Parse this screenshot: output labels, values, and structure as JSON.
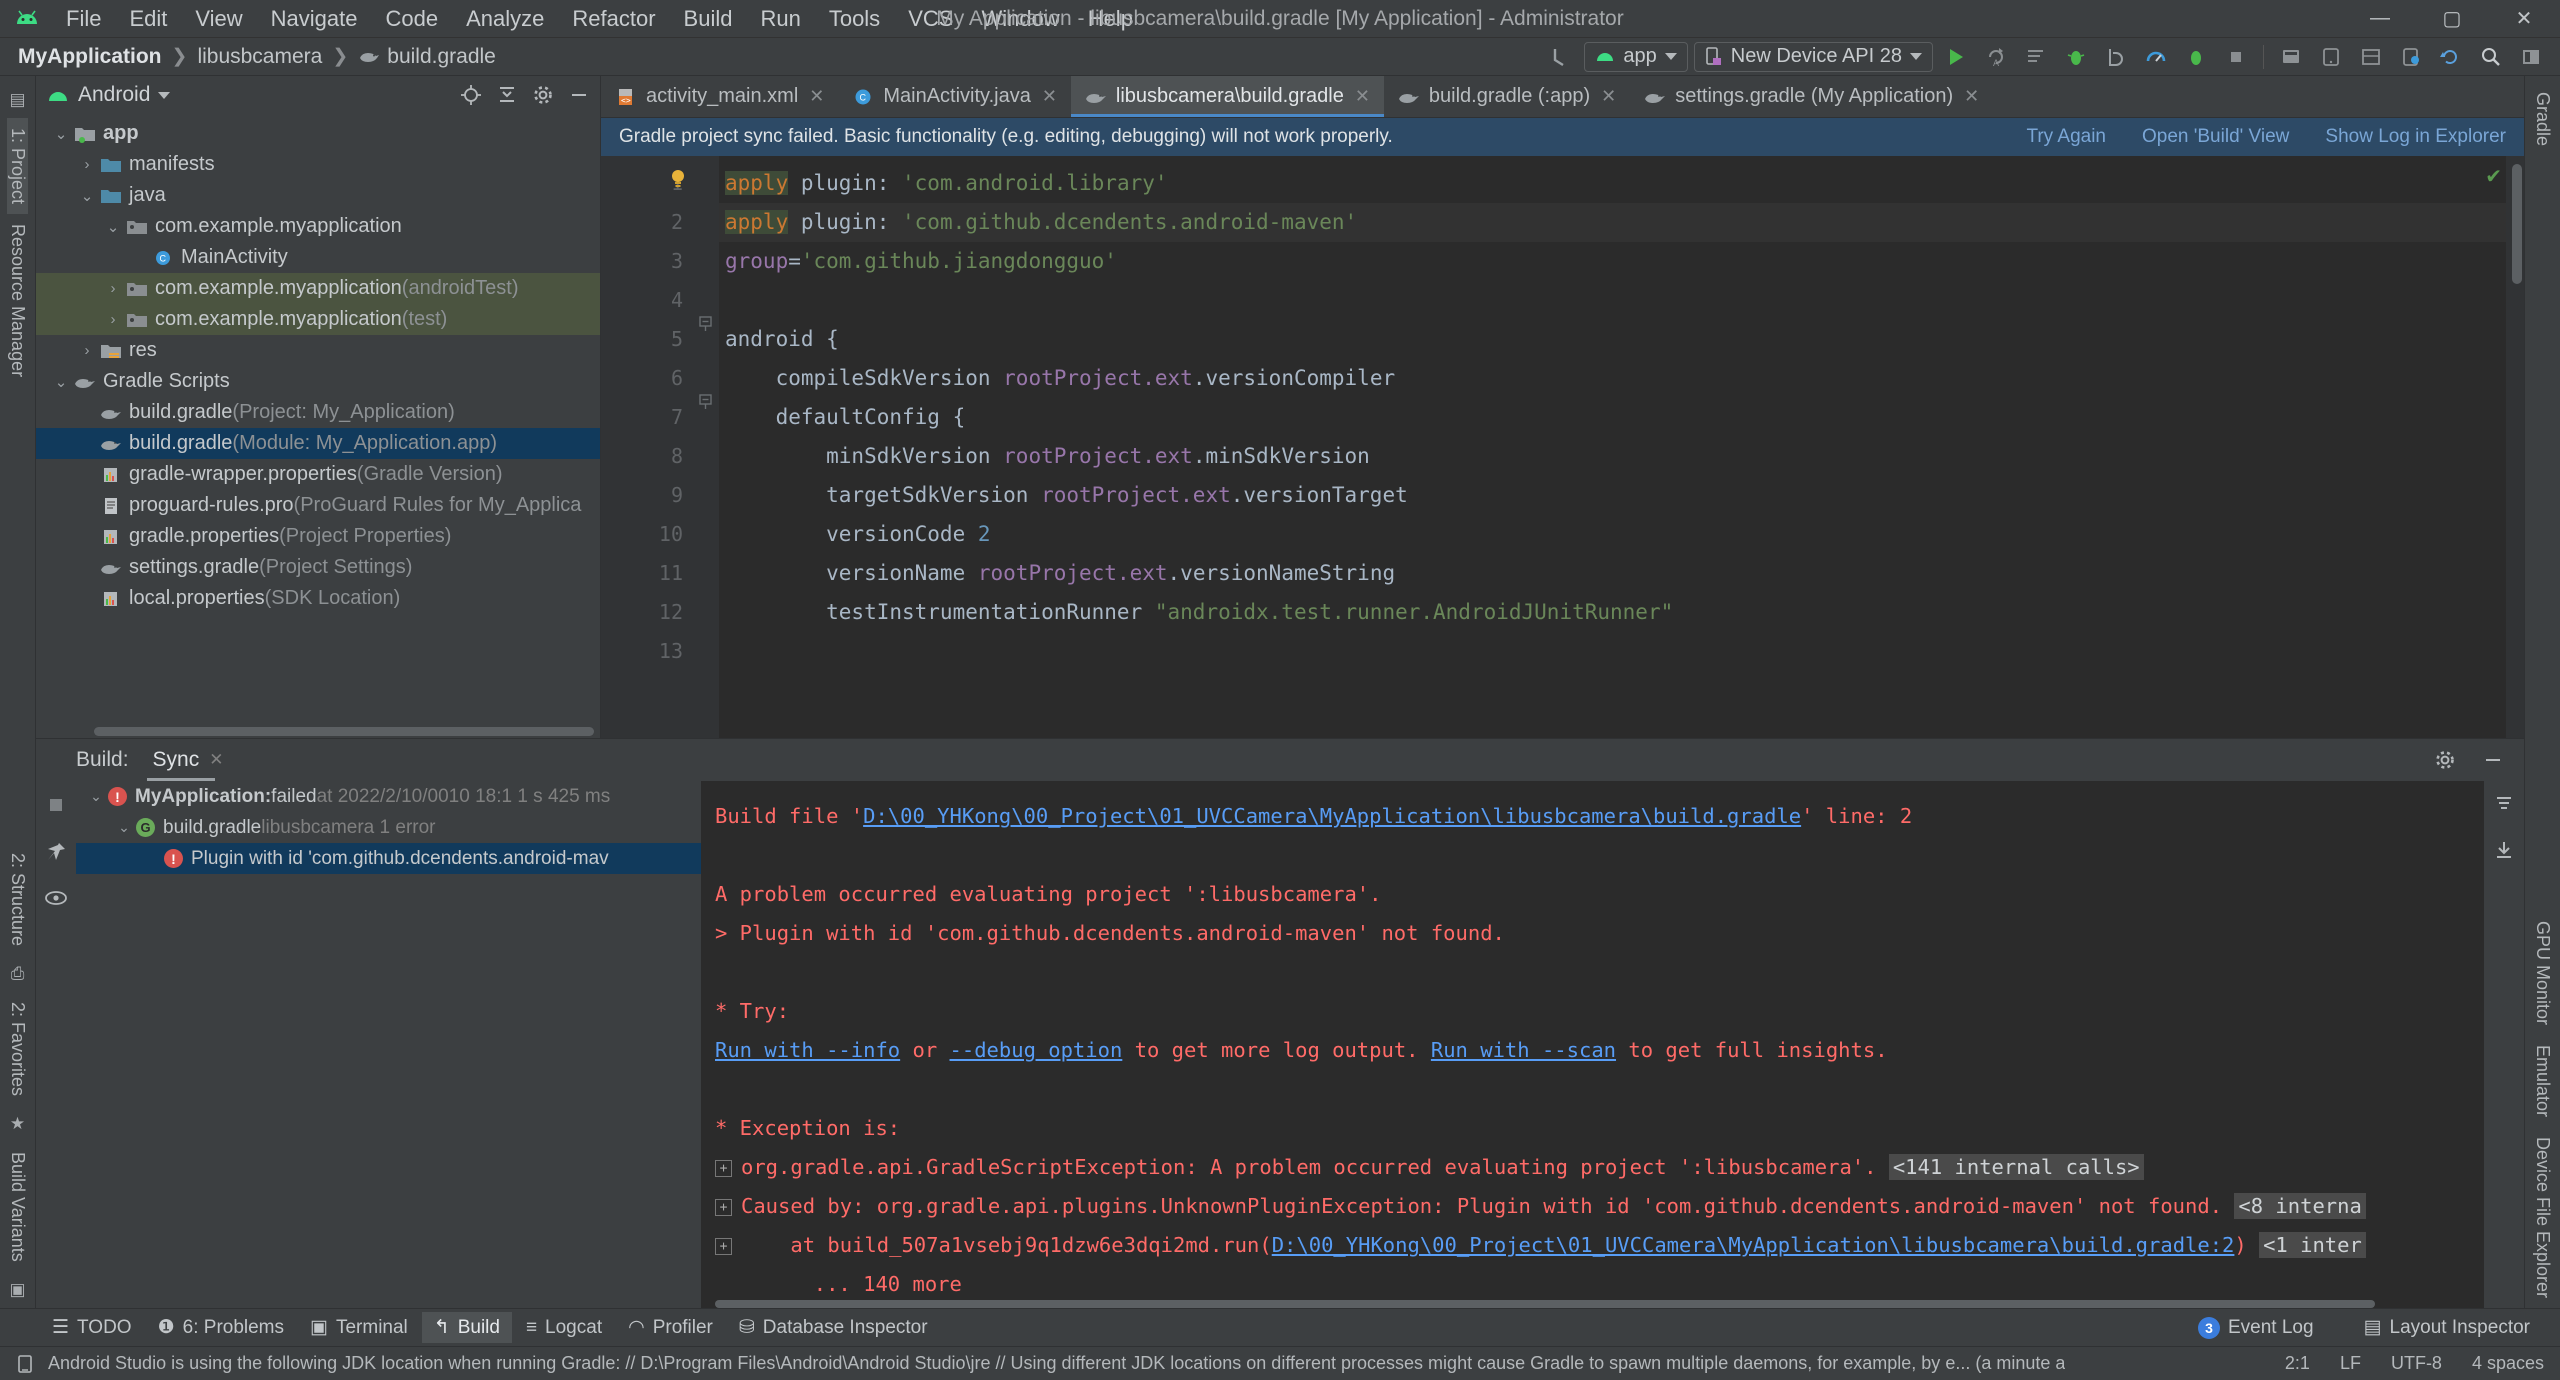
{
  "window": {
    "title": "My Application - libusbcamera\\build.gradle [My Application] - Administrator",
    "minimize": "—",
    "maximize": "▢",
    "close": "✕"
  },
  "menu": [
    "File",
    "Edit",
    "View",
    "Navigate",
    "Code",
    "Analyze",
    "Refactor",
    "Build",
    "Run",
    "Tools",
    "VCS",
    "Window",
    "Help"
  ],
  "breadcrumb": [
    {
      "label": "MyApplication",
      "bold": true
    },
    {
      "label": "libusbcamera",
      "bold": false
    },
    {
      "label": "build.gradle",
      "bold": false,
      "icon": "gradle-icon"
    }
  ],
  "toolbar": {
    "back_label": "↰",
    "module_combo": "app",
    "device_combo": "New Device API 28",
    "icons": [
      "run-icon",
      "apply-changes-icon",
      "apply-code-changes-icon",
      "debug-icon",
      "attach-debugger-icon",
      "profiler-icon",
      "profile-icon",
      "stop-icon",
      "sdk-manager-icon",
      "avd-manager-icon",
      "layout-inspector-icon",
      "device-file-explorer-icon",
      "sync-gradle-icon",
      "search-icon",
      "project-structure-icon"
    ]
  },
  "project_panel": {
    "title": "Android",
    "head_icons": [
      "locate-icon",
      "collapse-all-icon",
      "settings-icon",
      "hide-icon"
    ],
    "tree": [
      {
        "indent": 0,
        "arrow": "v",
        "icon": "module-folder-icon",
        "label": "app",
        "suffix": "",
        "bold": true,
        "state": "normal"
      },
      {
        "indent": 1,
        "arrow": ">",
        "icon": "folder-icon",
        "label": "manifests",
        "suffix": "",
        "bold": false,
        "state": "normal"
      },
      {
        "indent": 1,
        "arrow": "v",
        "icon": "folder-icon",
        "label": "java",
        "suffix": "",
        "bold": false,
        "state": "normal"
      },
      {
        "indent": 2,
        "arrow": "v",
        "icon": "package-icon",
        "label": "com.example.myapplication",
        "suffix": "",
        "bold": false,
        "state": "normal"
      },
      {
        "indent": 3,
        "arrow": "",
        "icon": "class-icon",
        "label": "MainActivity",
        "suffix": "",
        "bold": false,
        "state": "normal"
      },
      {
        "indent": 2,
        "arrow": ">",
        "icon": "package-icon",
        "label": "com.example.myapplication",
        "suffix": "(androidTest)",
        "bold": false,
        "state": "green"
      },
      {
        "indent": 2,
        "arrow": ">",
        "icon": "package-icon",
        "label": "com.example.myapplication",
        "suffix": "(test)",
        "bold": false,
        "state": "green"
      },
      {
        "indent": 1,
        "arrow": ">",
        "icon": "res-folder-icon",
        "label": "res",
        "suffix": "",
        "bold": false,
        "state": "normal"
      },
      {
        "indent": 0,
        "arrow": "v",
        "icon": "gradle-icon",
        "label": "Gradle Scripts",
        "suffix": "",
        "bold": false,
        "state": "normal"
      },
      {
        "indent": 1,
        "arrow": "",
        "icon": "gradle-icon",
        "label": "build.gradle",
        "suffix": "(Project: My_Application)",
        "bold": false,
        "state": "normal"
      },
      {
        "indent": 1,
        "arrow": "",
        "icon": "gradle-icon",
        "label": "build.gradle",
        "suffix": "(Module: My_Application.app)",
        "bold": false,
        "state": "selected"
      },
      {
        "indent": 1,
        "arrow": "",
        "icon": "properties-icon",
        "label": "gradle-wrapper.properties",
        "suffix": "(Gradle Version)",
        "bold": false,
        "state": "normal"
      },
      {
        "indent": 1,
        "arrow": "",
        "icon": "file-icon",
        "label": "proguard-rules.pro",
        "suffix": "(ProGuard Rules for My_Applica",
        "bold": false,
        "state": "normal"
      },
      {
        "indent": 1,
        "arrow": "",
        "icon": "properties-icon",
        "label": "gradle.properties",
        "suffix": "(Project Properties)",
        "bold": false,
        "state": "normal"
      },
      {
        "indent": 1,
        "arrow": "",
        "icon": "gradle-icon",
        "label": "settings.gradle",
        "suffix": "(Project Settings)",
        "bold": false,
        "state": "normal"
      },
      {
        "indent": 1,
        "arrow": "",
        "icon": "properties-icon",
        "label": "local.properties",
        "suffix": "(SDK Location)",
        "bold": false,
        "state": "normal"
      }
    ]
  },
  "left_rail": [
    {
      "label": "1: Project",
      "selected": true
    },
    {
      "label": "Resource Manager",
      "selected": false
    }
  ],
  "right_rail": [
    {
      "label": "Gradle"
    },
    {
      "label": "GPU Monitor"
    },
    {
      "label": "Emulator"
    },
    {
      "label": "Device File Explorer"
    }
  ],
  "bottom_left_rail": [
    {
      "label": "2: Structure"
    },
    {
      "label": "2: Favorites"
    },
    {
      "label": "Build Variants"
    }
  ],
  "editor_tabs": [
    {
      "label": "activity_main.xml",
      "icon": "xml-layout-icon",
      "active": false
    },
    {
      "label": "MainActivity.java",
      "icon": "java-class-icon",
      "active": false
    },
    {
      "label": "libusbcamera\\build.gradle",
      "icon": "gradle-icon",
      "active": true
    },
    {
      "label": "build.gradle (:app)",
      "icon": "gradle-icon",
      "active": false
    },
    {
      "label": "settings.gradle (My Application)",
      "icon": "gradle-icon",
      "active": false
    }
  ],
  "sync_banner": {
    "message": "Gradle project sync failed. Basic functionality (e.g. editing, debugging) will not work properly.",
    "links": [
      "Try Again",
      "Open 'Build' View",
      "Show Log in Explorer"
    ]
  },
  "editor": {
    "line_numbers": [
      "1",
      "2",
      "3",
      "4",
      "5",
      "6",
      "7",
      "8",
      "9",
      "10",
      "11",
      "12",
      "13"
    ],
    "code_lines": [
      [
        {
          "t": "apply",
          "c": "kw"
        },
        {
          "t": " plugin: ",
          "c": "pln"
        },
        {
          "t": "'com.android.library'",
          "c": "str"
        }
      ],
      [
        {
          "t": "apply",
          "c": "kw"
        },
        {
          "t": " plugin: ",
          "c": "pln"
        },
        {
          "t": "'com.github.dcendents.android-maven'",
          "c": "str"
        }
      ],
      [
        {
          "t": "group",
          "c": "fld"
        },
        {
          "t": "=",
          "c": "pln"
        },
        {
          "t": "'com.github.jiangdongguo'",
          "c": "str"
        }
      ],
      [],
      [
        {
          "t": "android {",
          "c": "pln"
        }
      ],
      [
        {
          "t": "    compileSdkVersion ",
          "c": "pln"
        },
        {
          "t": "rootProject.ext",
          "c": "fld"
        },
        {
          "t": ".versionCompiler",
          "c": "pln"
        }
      ],
      [
        {
          "t": "    defaultConfig {",
          "c": "pln"
        }
      ],
      [
        {
          "t": "        minSdkVersion ",
          "c": "pln"
        },
        {
          "t": "rootProject.ext",
          "c": "fld"
        },
        {
          "t": ".minSdkVersion",
          "c": "pln"
        }
      ],
      [
        {
          "t": "        targetSdkVersion ",
          "c": "pln"
        },
        {
          "t": "rootProject.ext",
          "c": "fld"
        },
        {
          "t": ".versionTarget",
          "c": "pln"
        }
      ],
      [
        {
          "t": "        versionCode ",
          "c": "pln"
        },
        {
          "t": "2",
          "c": "num"
        }
      ],
      [
        {
          "t": "        versionName ",
          "c": "pln"
        },
        {
          "t": "rootProject.ext",
          "c": "fld"
        },
        {
          "t": ".versionNameString",
          "c": "pln"
        }
      ],
      [
        {
          "t": "        testInstrumentationRunner ",
          "c": "pln"
        },
        {
          "t": "\"androidx.test.runner.AndroidJUnitRunner\"",
          "c": "str"
        }
      ],
      []
    ]
  },
  "build_panel": {
    "label": "Build:",
    "tab": "Sync",
    "tab_close": "✕",
    "head_icons": [
      "settings-icon",
      "hide-icon"
    ],
    "rail_icons": [
      "stop-icon",
      "pin-icon",
      "eye-icon"
    ],
    "right_icons": [
      "filter-icon",
      "download-icon"
    ],
    "tree": [
      {
        "indent": 0,
        "arrow": "v",
        "icon": "error-icon",
        "label": "MyApplication:",
        "mid": "failed",
        "suffix": "at 2022/2/10/0010 18:1 1 s 425 ms",
        "state": "normal"
      },
      {
        "indent": 1,
        "arrow": "v",
        "icon": "gradle-badge-icon",
        "label": "build.gradle",
        "mid": "",
        "suffix": "libusbcamera 1 error",
        "state": "normal"
      },
      {
        "indent": 2,
        "arrow": "",
        "icon": "error-icon",
        "label": "Plugin with id 'com.github.dcendents.android-mav",
        "mid": "",
        "suffix": "",
        "state": "selected"
      }
    ],
    "console": [
      {
        "type": "mixed",
        "parts": [
          {
            "t": "Build file '",
            "c": "err"
          },
          {
            "t": "D:\\00_YHKong\\00_Project\\01_UVCCamera\\MyApplication\\libusbcamera\\build.gradle",
            "c": "link"
          },
          {
            "t": "' line: 2",
            "c": "err"
          }
        ]
      },
      {
        "type": "blank",
        "parts": []
      },
      {
        "type": "mixed",
        "parts": [
          {
            "t": "A problem occurred evaluating project ':libusbcamera'.",
            "c": "err"
          }
        ]
      },
      {
        "type": "mixed",
        "parts": [
          {
            "t": "> Plugin with id 'com.github.dcendents.android-maven' not found.",
            "c": "err"
          }
        ]
      },
      {
        "type": "blank",
        "parts": []
      },
      {
        "type": "mixed",
        "parts": [
          {
            "t": "* Try:",
            "c": "err"
          }
        ]
      },
      {
        "type": "mixed",
        "parts": [
          {
            "t": "Run with --info",
            "c": "link"
          },
          {
            "t": " or ",
            "c": "err"
          },
          {
            "t": "--debug option",
            "c": "link"
          },
          {
            "t": " to get more log output. ",
            "c": "err"
          },
          {
            "t": "Run with --scan",
            "c": "link"
          },
          {
            "t": " to get full insights.",
            "c": "err"
          }
        ]
      },
      {
        "type": "blank",
        "parts": []
      },
      {
        "type": "mixed",
        "parts": [
          {
            "t": "* Exception is:",
            "c": "err"
          }
        ]
      },
      {
        "type": "expand",
        "parts": [
          {
            "t": "org.gradle.api.GradleScriptException: A problem occurred evaluating project ':libusbcamera'. ",
            "c": "err"
          },
          {
            "t": "<141 internal calls>",
            "c": "grayblk"
          }
        ]
      },
      {
        "type": "expand",
        "parts": [
          {
            "t": "Caused by: org.gradle.api.plugins.UnknownPluginException: Plugin with id 'com.github.dcendents.android-maven' not found. ",
            "c": "err"
          },
          {
            "t": "<8 interna",
            "c": "grayblk"
          }
        ]
      },
      {
        "type": "expand",
        "parts": [
          {
            "t": "    at build_507a1vsebj9q1dzw6e3dqi2md.run(",
            "c": "err"
          },
          {
            "t": "D:\\00_YHKong\\00_Project\\01_UVCCamera\\MyApplication\\libusbcamera\\build.gradle:2",
            "c": "link"
          },
          {
            "t": ") ",
            "c": "err"
          },
          {
            "t": "<1 inter",
            "c": "grayblk"
          }
        ]
      },
      {
        "type": "mixed",
        "parts": [
          {
            "t": "        ... 140 more",
            "c": "err"
          }
        ]
      }
    ]
  },
  "tool_window_bar": {
    "items": [
      {
        "label": "TODO",
        "icon": "todo-icon",
        "active": false
      },
      {
        "label": "6: Problems",
        "icon": "problems-icon",
        "active": false
      },
      {
        "label": "Terminal",
        "icon": "terminal-icon",
        "active": false
      },
      {
        "label": "Build",
        "icon": "build-icon",
        "active": true
      },
      {
        "label": "Logcat",
        "icon": "logcat-icon",
        "active": false
      },
      {
        "label": "Profiler",
        "icon": "profiler-icon",
        "active": false
      },
      {
        "label": "Database Inspector",
        "icon": "database-icon",
        "active": false
      }
    ],
    "right": [
      {
        "label": "Event Log",
        "icon": "event-log-icon",
        "badge": "3"
      },
      {
        "label": "Layout Inspector",
        "icon": "layout-inspector-icon",
        "badge": ""
      }
    ]
  },
  "statusbar": {
    "message": "Android Studio is using the following JDK location when running Gradle: // D:\\Program Files\\Android\\Android Studio\\jre // Using different JDK locations on different processes might cause Gradle to spawn multiple daemons, for example, by e... (a minute a",
    "icon": "info-icon",
    "right": [
      "2:1",
      "LF",
      "UTF-8",
      "4 spaces"
    ]
  }
}
